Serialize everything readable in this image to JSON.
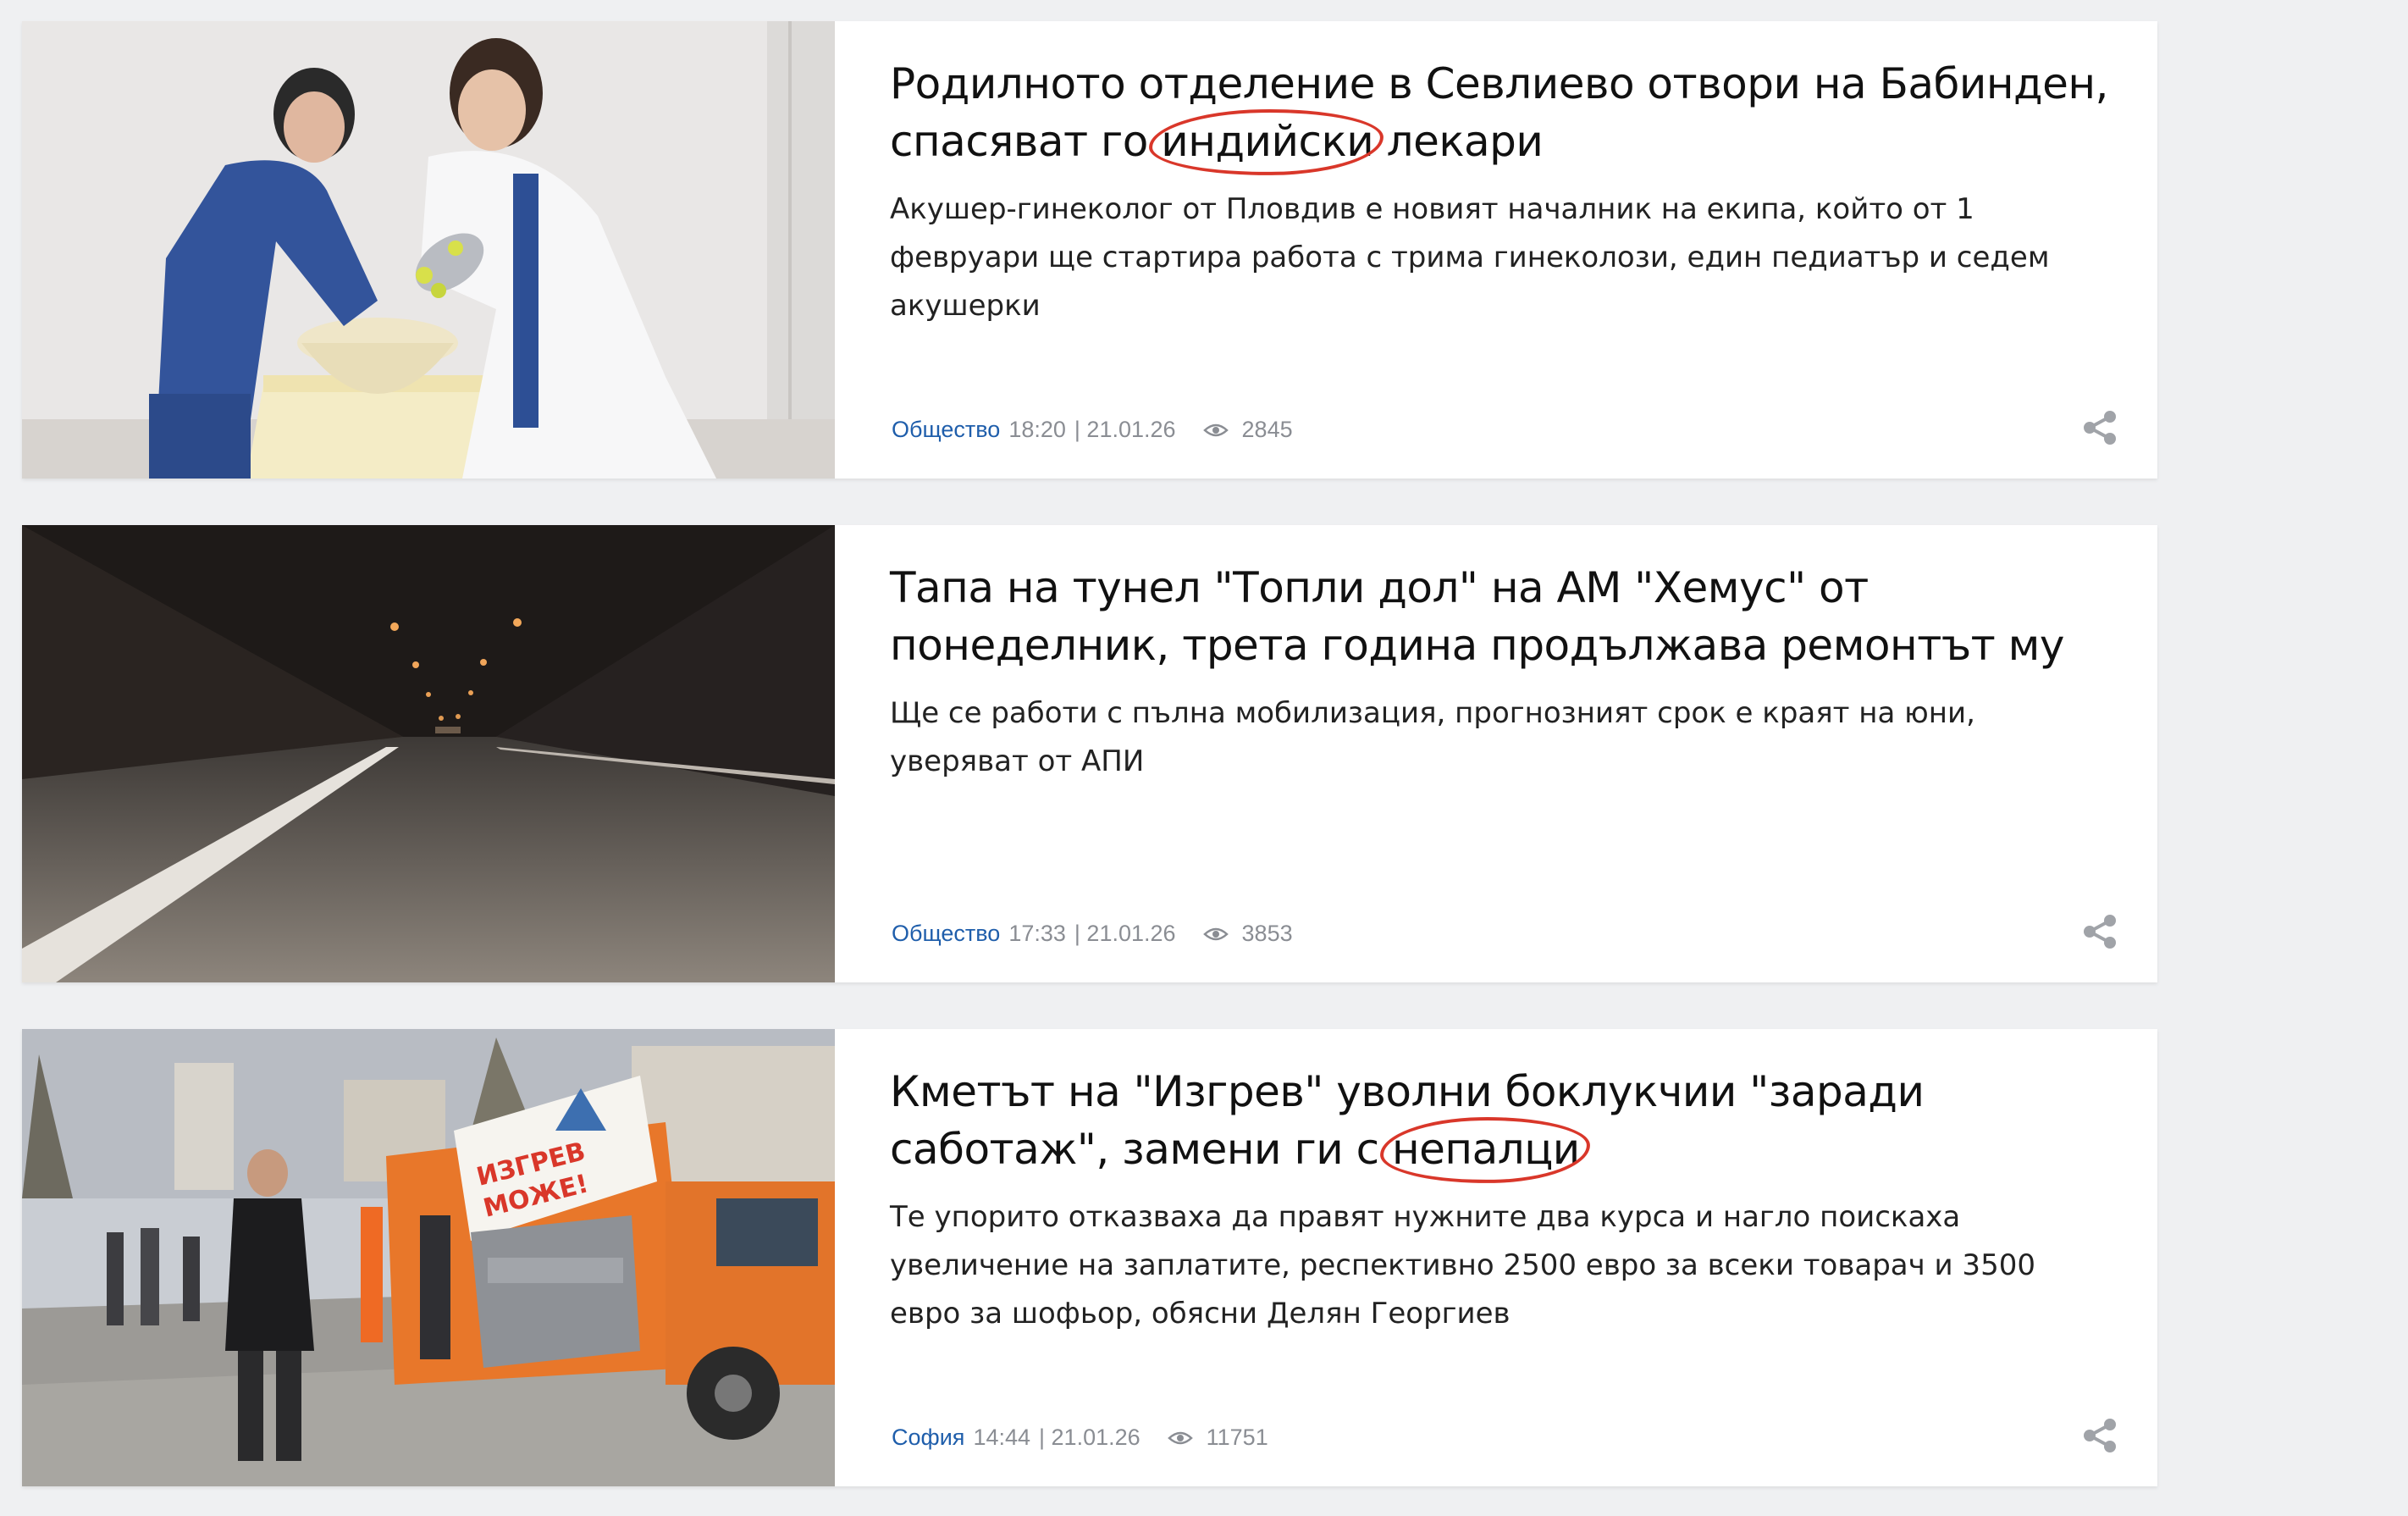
{
  "colors": {
    "background": "#eff0f2",
    "card": "#ffffff",
    "category_link": "#1f5eab",
    "meta_text": "#8a8d93",
    "highlight_circle": "#d9372a"
  },
  "icons": {
    "views": "eye-icon",
    "share": "share-icon"
  },
  "articles": [
    {
      "title_before": "Родилното отделение в Севлиево отвори на Бабинден, спасяват го ",
      "title_highlight": "индийски",
      "title_after": " лекари",
      "summary": "Акушер-гинеколог от Пловдив е новият началник на екипа, който от 1 февруари ще стартира работа с трима гинеколози, един педиатър и седем акушерки",
      "category": "Общество",
      "time": "18:20",
      "date": "| 21.01.26",
      "views": "2845",
      "image_alt": "Two women in medical uniforms pouring water into a basin"
    },
    {
      "title_before": "Тапа на тунел \"Топли дол\" на АМ \"Хемус\" от понеделник, трета година продължава ремонтът му",
      "title_highlight": "",
      "title_after": "",
      "summary": "Ще се работи с пълна мобилизация, прогнозният срок е краят на юни, уверяват от АПИ",
      "category": "Общество",
      "time": "17:33",
      "date": "| 21.01.26",
      "views": "3853",
      "image_alt": "Road tunnel interior"
    },
    {
      "title_before": "Кметът на \"Изгрев\" уволни боклукчии \"заради саботаж\", замени ги с ",
      "title_highlight": "непалци",
      "title_after": "",
      "summary": "Те упорито отказваха да правят нужните два курса и нагло поискаха увеличение на заплатите, респективно 2500 евро за всеки товарач и 3500 евро за шофьор, обясни Делян Георгиев",
      "category": "София",
      "time": "14:44",
      "date": "| 21.01.26",
      "views": "11751",
      "image_alt": "Man speaking near an orange garbage truck"
    }
  ],
  "image_banner_text": {
    "line1": "ИЗГРЕВ",
    "line2": "МОЖЕ!"
  }
}
